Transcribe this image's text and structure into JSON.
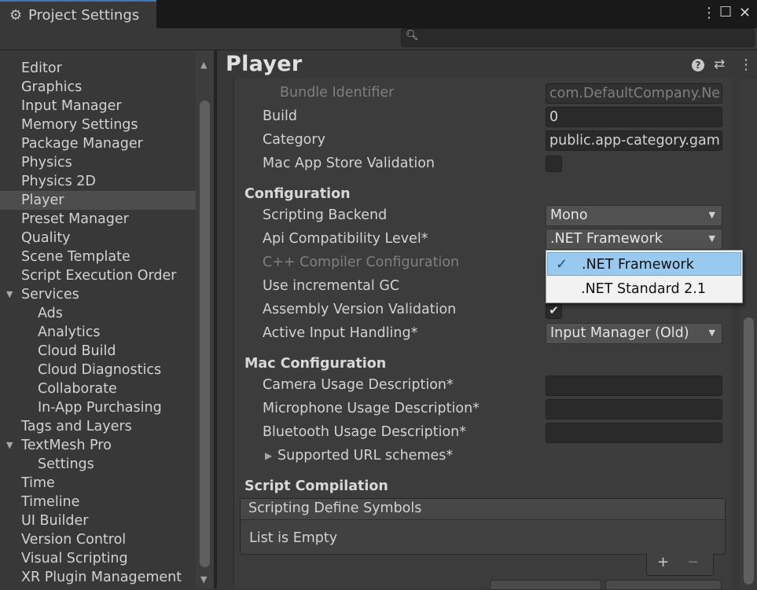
{
  "window": {
    "tab_title": "Project Settings",
    "menu_glyph": "⋮",
    "maximize_glyph": "☐",
    "close_glyph": "✕"
  },
  "search": {
    "icon": "search-icon",
    "value": ""
  },
  "sidebar": {
    "items": [
      {
        "label": "Editor"
      },
      {
        "label": "Graphics"
      },
      {
        "label": "Input Manager"
      },
      {
        "label": "Memory Settings"
      },
      {
        "label": "Package Manager"
      },
      {
        "label": "Physics"
      },
      {
        "label": "Physics 2D"
      },
      {
        "label": "Player"
      },
      {
        "label": "Preset Manager"
      },
      {
        "label": "Quality"
      },
      {
        "label": "Scene Template"
      },
      {
        "label": "Script Execution Order"
      },
      {
        "label": "Services"
      },
      {
        "label": "Ads"
      },
      {
        "label": "Analytics"
      },
      {
        "label": "Cloud Build"
      },
      {
        "label": "Cloud Diagnostics"
      },
      {
        "label": "Collaborate"
      },
      {
        "label": "In-App Purchasing"
      },
      {
        "label": "Tags and Layers"
      },
      {
        "label": "TextMesh Pro"
      },
      {
        "label": "Settings"
      },
      {
        "label": "Time"
      },
      {
        "label": "Timeline"
      },
      {
        "label": "UI Builder"
      },
      {
        "label": "Version Control"
      },
      {
        "label": "Visual Scripting"
      },
      {
        "label": "XR Plugin Management"
      }
    ],
    "selected": "Player"
  },
  "player": {
    "title": "Player",
    "header_icons": [
      "help-icon",
      "presets-icon",
      "more-icon"
    ],
    "bundle_identifier": {
      "label": "Bundle Identifier",
      "value": "com.DefaultCompany.Ne"
    },
    "build": {
      "label": "Build",
      "value": "0"
    },
    "category": {
      "label": "Category",
      "value": "public.app-category.gam"
    },
    "mac_app_store_validation": {
      "label": "Mac App Store Validation",
      "checked": false
    },
    "configuration": {
      "header": "Configuration",
      "scripting_backend": {
        "label": "Scripting Backend",
        "value": "Mono"
      },
      "api_compat": {
        "label": "Api Compatibility Level*",
        "value": ".NET Framework"
      },
      "cpp_compiler": {
        "label": "C++ Compiler Configuration"
      },
      "incremental_gc": {
        "label": "Use incremental GC"
      },
      "assembly_validation": {
        "label": "Assembly Version Validation",
        "checked": true,
        "check_glyph": "✔"
      },
      "active_input": {
        "label": "Active Input Handling*",
        "value": "Input Manager (Old)"
      }
    },
    "api_dropdown_options": [
      {
        "label": ".NET Framework",
        "selected": true,
        "check_glyph": "✓"
      },
      {
        "label": ".NET Standard 2.1",
        "selected": false
      }
    ],
    "mac_configuration": {
      "header": "Mac Configuration",
      "camera": {
        "label": "Camera Usage Description*",
        "value": ""
      },
      "microphone": {
        "label": "Microphone Usage Description*",
        "value": ""
      },
      "bluetooth": {
        "label": "Bluetooth Usage Description*",
        "value": ""
      },
      "url_schemes": {
        "label": "Supported URL schemes*"
      }
    },
    "script_compilation": {
      "header": "Script Compilation",
      "list_title": "Scripting Define Symbols",
      "list_empty": "List is Empty",
      "add_glyph": "+",
      "remove_glyph": "−"
    }
  }
}
